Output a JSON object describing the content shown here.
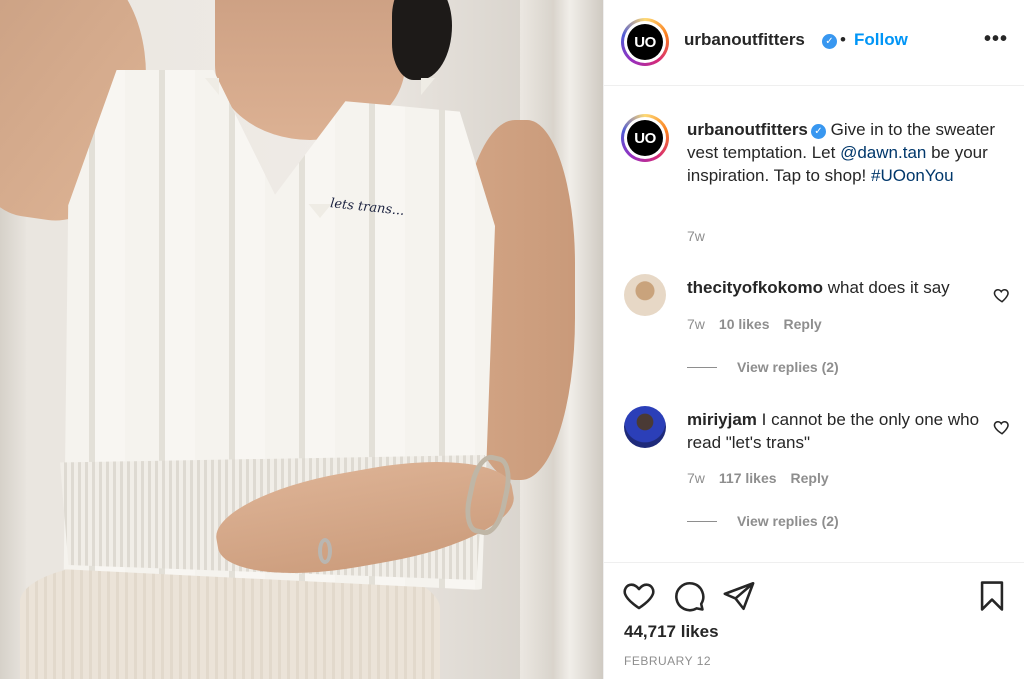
{
  "post": {
    "account": {
      "username": "urbanoutfitters",
      "avatar_initials": "UO",
      "verified": true,
      "follow_label": "Follow",
      "separator": "•"
    },
    "photo_embroidery": "lets trans...",
    "caption": {
      "username": "urbanoutfitters",
      "text_1": " Give in to the sweater vest temptation. Let ",
      "mention": "@dawn.tan",
      "text_2": " be your inspiration. Tap to shop! ",
      "hashtag": "#UOonYou",
      "time": "7w"
    },
    "comments": [
      {
        "username": "thecityofkokomo",
        "text": " what does it say",
        "time": "7w",
        "likes": "10 likes",
        "reply_label": "Reply",
        "view_replies": "View replies (2)"
      },
      {
        "username": "miriyjam",
        "text": " I cannot be the only one who read \"let's trans\"",
        "time": "7w",
        "likes": "117 likes",
        "reply_label": "Reply",
        "view_replies": "View replies (2)"
      }
    ],
    "likes_count": "44,717 likes",
    "date": "FEBRUARY 12",
    "icons": {
      "more": "more-options-icon",
      "like": "heart-icon",
      "comment": "comment-bubble-icon",
      "share": "paper-plane-icon",
      "save": "bookmark-icon",
      "verified": "verified-badge-icon"
    },
    "colors": {
      "follow": "#0095f6",
      "link": "#00376b",
      "verified": "#3897f0",
      "meta_text": "#8e8e8e",
      "primary_text": "#262626"
    }
  }
}
